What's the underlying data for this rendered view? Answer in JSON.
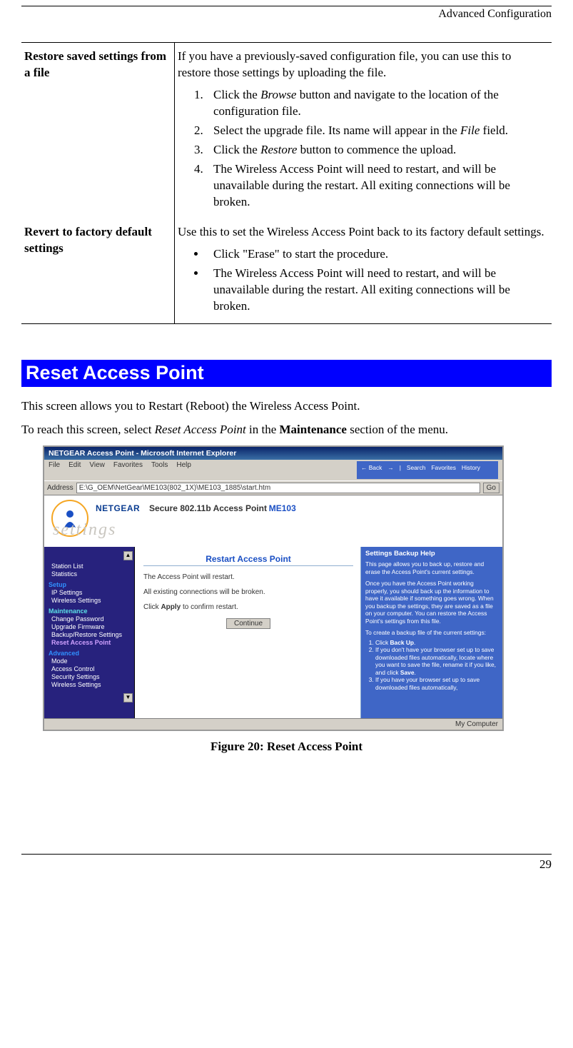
{
  "header": "Advanced Configuration",
  "table": {
    "row1": {
      "label": "Restore saved settings from a file",
      "intro": "If you have a previously-saved configuration file, you can use this to restore those settings by uploading the file.",
      "step1_a": "Click the ",
      "step1_it": "Browse",
      "step1_b": " button and navigate to the location of the configuration file.",
      "step2_a": "Select the upgrade file. Its name will appear in the ",
      "step2_it": "File",
      "step2_b": " field.",
      "step3_a": "Click the ",
      "step3_it": "Restore",
      "step3_b": " button to commence the upload.",
      "step4": "The Wireless Access Point will need to restart, and will be unavailable during the restart. All exiting connections will be broken."
    },
    "row2": {
      "label": "Revert to factory default settings",
      "intro": "Use this to set the Wireless Access Point back to its factory default settings.",
      "b1": "Click \"Erase\" to start the procedure.",
      "b2": "The Wireless Access Point will need to restart, and will be unavailable during the restart. All exiting connections will be broken."
    }
  },
  "section_title": "Reset Access Point",
  "p1": "This screen allows you to Restart (Reboot) the Wireless Access Point.",
  "p2_a": "To reach this screen, select ",
  "p2_it": "Reset Access Point",
  "p2_b": " in the ",
  "p2_bold": "Maintenance",
  "p2_c": " section of the menu.",
  "mock": {
    "title": "NETGEAR Access Point - Microsoft Internet Explorer",
    "menu": {
      "file": "File",
      "edit": "Edit",
      "view": "View",
      "fav": "Favorites",
      "tools": "Tools",
      "help": "Help",
      "back": "← Back",
      "fwd": "→",
      "search": "Search",
      "favb": "Favorites",
      "hist": "History"
    },
    "addr_label": "Address",
    "addr_value": "E:\\G_OEM\\NetGear\\ME103(802_1X)\\ME103_1885\\start.htm",
    "go": "Go",
    "brand": {
      "ng": "NETGEAR",
      "sp": "Secure 802.11b Access Point",
      "model": "ME103",
      "settings": "settings"
    },
    "sidebar": {
      "cat0_i1": "Station List",
      "cat0_i2": "Statistics",
      "cat1": "Setup",
      "cat1_i1": "IP Settings",
      "cat1_i2": "Wireless Settings",
      "cat2": "Maintenance",
      "cat2_i1": "Change Password",
      "cat2_i2": "Upgrade Firmware",
      "cat2_i3": "Backup/Restore Settings",
      "cat2_i4": "Reset Access Point",
      "cat3": "Advanced",
      "cat3_i1": "Mode",
      "cat3_i2": "Access Control",
      "cat3_i3": "Security Settings",
      "cat3_i4": "Wireless Settings"
    },
    "center": {
      "heading": "Restart Access Point",
      "l1": "The Access Point will restart.",
      "l2": "All existing connections will be broken.",
      "l3a": "Click ",
      "l3b": "Apply",
      "l3c": " to confirm restart.",
      "btn": "Continue"
    },
    "help": {
      "h": "Settings Backup Help",
      "p1": "This page allows you to back up, restore and erase the Access Point's current settings.",
      "p2": "Once you have the Access Point working properly, you should back up the information to have it available if something goes wrong. When you backup the settings, they are saved as a file on your computer. You can restore the Access Point's settings from this file.",
      "p3": "To create a backup file of the current settings:",
      "o1a": "Click ",
      "o1b": "Back Up",
      "o2a": "If you don't have your browser set up to save downloaded files automatically, locate where you want to save the file, rename it if you like, and click ",
      "o2b": "Save",
      "o3": "If you have your browser set up to save downloaded files automatically,"
    },
    "status": "My Computer"
  },
  "figure_caption": "Figure 20: Reset Access Point",
  "page_number": "29"
}
